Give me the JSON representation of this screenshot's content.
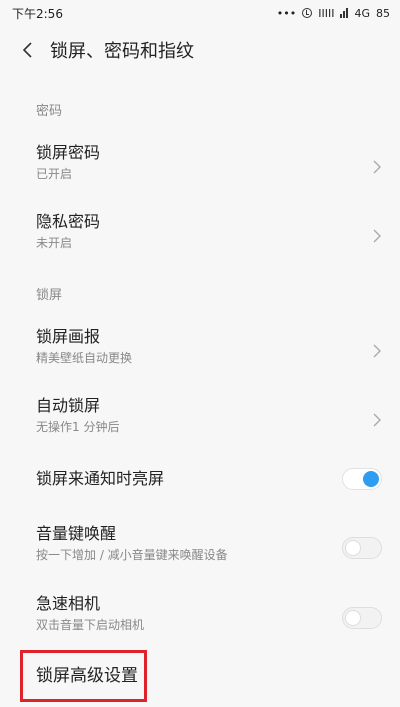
{
  "status_bar": {
    "time": "下午2:56",
    "dots": "•••",
    "signal_text": "IIIII",
    "network": "4G",
    "battery": "85"
  },
  "header": {
    "title": "锁屏、密码和指纹"
  },
  "sections": {
    "password": "密码",
    "lockscreen": "锁屏"
  },
  "rows": {
    "lock_password": {
      "title": "锁屏密码",
      "sub": "已开启"
    },
    "privacy_password": {
      "title": "隐私密码",
      "sub": "未开启"
    },
    "lock_pictorial": {
      "title": "锁屏画报",
      "sub": "精美壁纸自动更换"
    },
    "auto_lock": {
      "title": "自动锁屏",
      "sub": "无操作1 分钟后"
    },
    "notify_wake": {
      "title": "锁屏来通知时亮屏",
      "toggle": "on"
    },
    "volume_wake": {
      "title": "音量键唤醒",
      "sub": "按一下增加 / 减小音量键来唤醒设备",
      "toggle": "off"
    },
    "quick_camera": {
      "title": "急速相机",
      "sub": "双击音量下启动相机",
      "toggle": "off"
    },
    "advanced": {
      "title": "锁屏高级设置"
    }
  },
  "colors": {
    "accent": "#2e9cf0",
    "highlight": "#e0232b"
  }
}
